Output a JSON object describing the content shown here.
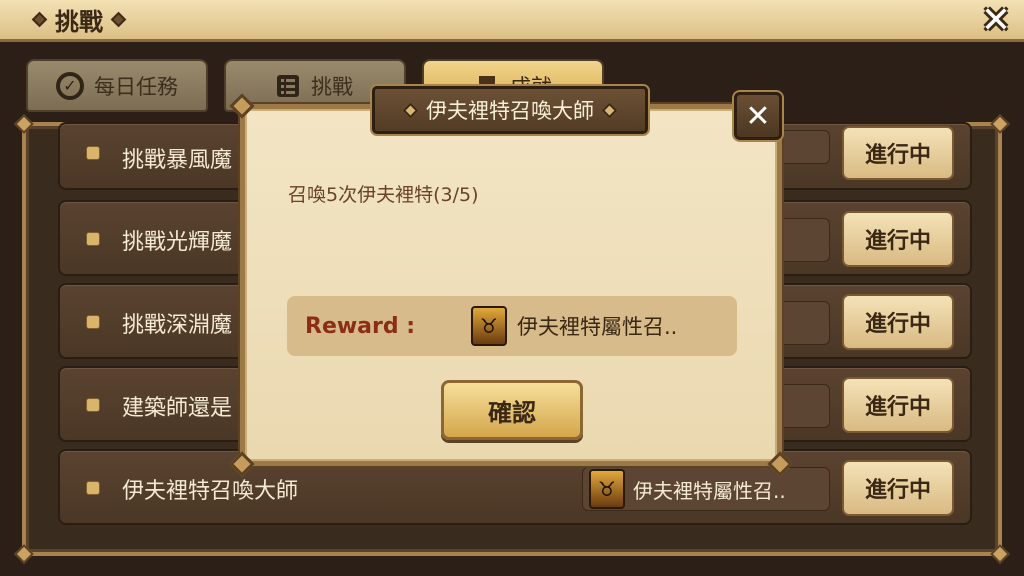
{
  "window": {
    "title": "挑戰",
    "close_icon": "close-icon"
  },
  "tabs": [
    {
      "label": "每日任務",
      "icon": "check-circle-icon",
      "active": false
    },
    {
      "label": "挑戰",
      "icon": "list-icon",
      "active": false
    },
    {
      "label": "成就",
      "icon": "trophy-icon",
      "active": true
    }
  ],
  "rows": [
    {
      "name": "挑戰暴風魔",
      "status": "進行中"
    },
    {
      "name": "挑戰光輝魔",
      "status": "進行中"
    },
    {
      "name": "挑戰深淵魔",
      "status": "進行中"
    },
    {
      "name": "建築師還是",
      "status": "進行中"
    },
    {
      "name": "伊夫裡特召喚大師",
      "reward": "伊夫裡特屬性召..",
      "status": "進行中"
    }
  ],
  "modal": {
    "title": "伊夫裡特召喚大師",
    "description": "召喚5次伊夫裡特(3/5)",
    "reward_label": "Reward :",
    "reward_text": "伊夫裡特屬性召..",
    "confirm_label": "確認",
    "close_label": "✕"
  },
  "colors": {
    "accent": "#d6a84b",
    "reward_label": "#8a2e1a",
    "panel_bg": "#3a2b1f"
  }
}
